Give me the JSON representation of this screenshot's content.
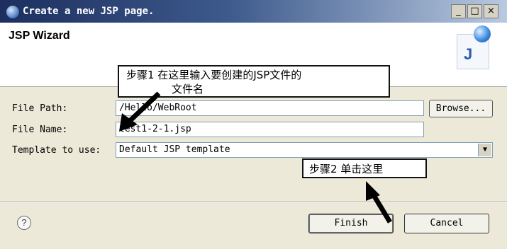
{
  "window": {
    "title": "Create a new JSP page.",
    "minimize": "_",
    "maximize": "□",
    "close": "×"
  },
  "header": {
    "title": "JSP Wizard",
    "logo_letter": "J"
  },
  "form": {
    "file_path_label": "File Path:",
    "file_path_value": "/Hello/WebRoot",
    "browse_label": "Browse...",
    "file_name_label": "File Name:",
    "file_name_value": "test1-2-1.jsp",
    "template_label": "Template to use:",
    "template_value": "Default JSP template",
    "template_arrow": "▼"
  },
  "footer": {
    "help": "?",
    "finish_label": "Finish",
    "cancel_label": "Cancel"
  },
  "annotations": {
    "step1_line1": "步骤1  在这里输入要创建的JSP文件的",
    "step1_line2": "文件名",
    "step2": "步骤2    单击这里"
  },
  "colors": {
    "title_bar_start": "#1c2f5f",
    "dialog_background": "#ece9d8",
    "field_border": "#7f9db9"
  },
  "icons": [
    "window-icon",
    "jsp-logo-icon",
    "help-icon",
    "dropdown-arrow-icon"
  ]
}
